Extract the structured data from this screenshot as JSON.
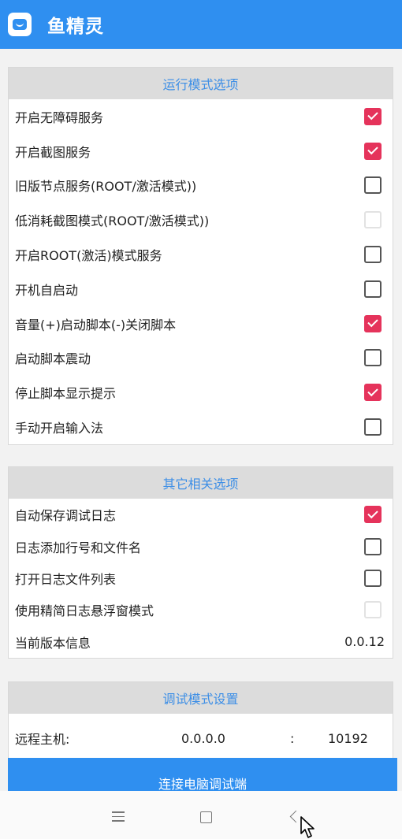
{
  "app": {
    "title": "鱼精灵"
  },
  "run_mode": {
    "header": "运行模式选项",
    "items": [
      {
        "label": "开启无障碍服务",
        "state": "checked"
      },
      {
        "label": "开启截图服务",
        "state": "checked"
      },
      {
        "label": "旧版节点服务(ROOT/激活模式))",
        "state": "unchecked"
      },
      {
        "label": "低消耗截图模式(ROOT/激活模式))",
        "state": "disabled"
      },
      {
        "label": "开启ROOT(激活)模式服务",
        "state": "unchecked"
      },
      {
        "label": "开机自启动",
        "state": "unchecked"
      },
      {
        "label": "音量(+)启动脚本(-)关闭脚本",
        "state": "checked"
      },
      {
        "label": "启动脚本震动",
        "state": "unchecked"
      },
      {
        "label": "停止脚本显示提示",
        "state": "checked"
      },
      {
        "label": "手动开启输入法",
        "state": "unchecked"
      }
    ]
  },
  "other": {
    "header": "其它相关选项",
    "items": [
      {
        "label": "自动保存调试日志",
        "state": "checked"
      },
      {
        "label": "日志添加行号和文件名",
        "state": "unchecked"
      },
      {
        "label": "打开日志文件列表",
        "state": "unchecked"
      },
      {
        "label": "使用精简日志悬浮窗模式",
        "state": "disabled"
      }
    ],
    "version_label": "当前版本信息",
    "version_value": "0.0.12"
  },
  "debug": {
    "header": "调试模式设置",
    "remote_label": "远程主机:",
    "remote_ip": "0.0.0.0",
    "separator": ":",
    "remote_port": "10192",
    "connect_button": "连接电脑调试端"
  },
  "colors": {
    "accent": "#2f8ff0",
    "checked": "#e5335b",
    "header_text": "#3c8ee6"
  },
  "icons": {
    "app": "fish-app-icon",
    "nav_menu": "menu-icon",
    "nav_home": "home-icon",
    "nav_back": "back-icon",
    "pointer": "cursor-icon"
  }
}
